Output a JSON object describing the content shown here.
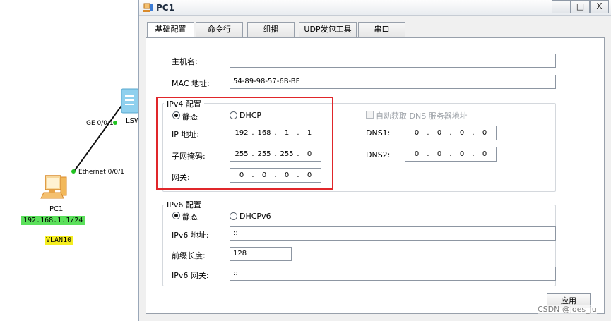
{
  "topology": {
    "switch_label": "LSW",
    "switch_port": "GE 0/0/1",
    "pc_port": "Ethernet 0/0/1",
    "pc_name": "PC1",
    "pc_ip_tag": "192.168.1.1/24",
    "vlan_tag": "VLAN10",
    "ip_tag_color": "#5be05b",
    "vlan_tag_color": "#f5ee20",
    "link_dot_color": "#22c322"
  },
  "window": {
    "title": "PC1",
    "minimize": "_",
    "maximize": "□",
    "close": "X"
  },
  "tabs": [
    {
      "label": "基础配置",
      "active": true
    },
    {
      "label": "命令行",
      "active": false
    },
    {
      "label": "组播",
      "active": false
    },
    {
      "label": "UDP发包工具",
      "active": false
    },
    {
      "label": "串口",
      "active": false
    }
  ],
  "basic": {
    "hostname_label": "主机名:",
    "hostname_value": "",
    "mac_label": "MAC 地址:",
    "mac_value": "54-89-98-57-6B-BF"
  },
  "ipv4": {
    "group_title": "IPv4 配置",
    "static_label": "静态",
    "dhcp_label": "DHCP",
    "mode": "static",
    "ip_label": "IP 地址:",
    "ip": [
      "192",
      "168",
      "1",
      "1"
    ],
    "mask_label": "子网掩码:",
    "mask": [
      "255",
      "255",
      "255",
      "0"
    ],
    "gateway_label": "网关:",
    "gateway": [
      "0",
      "0",
      "0",
      "0"
    ],
    "auto_dns_label": "自动获取 DNS 服务器地址",
    "auto_dns_checked": false,
    "dns1_label": "DNS1:",
    "dns1": [
      "0",
      "0",
      "0",
      "0"
    ],
    "dns2_label": "DNS2:",
    "dns2": [
      "0",
      "0",
      "0",
      "0"
    ],
    "highlight_color": "#e0262a"
  },
  "ipv6": {
    "group_title": "IPv6 配置",
    "static_label": "静态",
    "dhcp_label": "DHCPv6",
    "mode": "static",
    "ip_label": "IPv6 地址:",
    "ip_value": "::",
    "prefix_label": "前缀长度:",
    "prefix_value": "128",
    "gateway_label": "IPv6 网关:",
    "gateway_value": "::"
  },
  "apply_label": "应用",
  "watermark": "CSDN @joes_ju",
  "icons": {
    "switch": "switch-icon",
    "pc": "pc-icon",
    "app": "app-icon"
  }
}
